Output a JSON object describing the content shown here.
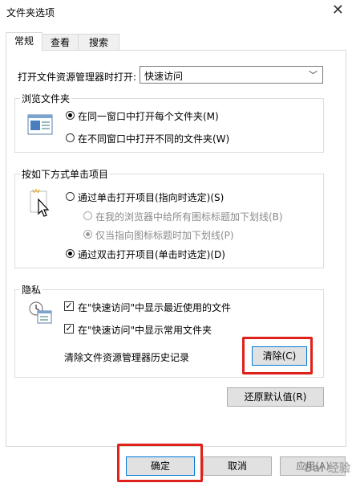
{
  "window": {
    "title": "文件夹选项"
  },
  "tabs": [
    {
      "label": "常规"
    },
    {
      "label": "查看"
    },
    {
      "label": "搜索"
    }
  ],
  "open_explorer": {
    "label": "打开文件资源管理器时打开:",
    "value": "快速访问"
  },
  "browse": {
    "title": "浏览文件夹",
    "options": [
      {
        "label": "在同一窗口中打开每个文件夹(M)",
        "selected": true
      },
      {
        "label": "在不同窗口中打开不同的文件夹(W)",
        "selected": false
      }
    ]
  },
  "click_items": {
    "title": "按如下方式单击项目",
    "single": "通过单击打开项目(指向时选定)(S)",
    "underline_all": "在我的浏览器中给所有图标标题加下划线(B)",
    "underline_hover": "仅当指向图标标题时加下划线(P)",
    "double": "通过双击打开项目(单击时选定)(D)"
  },
  "privacy": {
    "title": "隐私",
    "recent_files": "在\"快速访问\"中显示最近使用的文件",
    "frequent_folders": "在\"快速访问\"中显示常用文件夹",
    "clear_label": "清除文件资源管理器历史记录",
    "clear_button": "清除(C)"
  },
  "restore_button": "还原默认值(R)",
  "footer": {
    "ok": "确定",
    "cancel": "取消",
    "apply": "应用(A)"
  },
  "watermark": "Bai 经验",
  "colors": {
    "highlight": "#e0201b",
    "focus": "#0078d7"
  }
}
